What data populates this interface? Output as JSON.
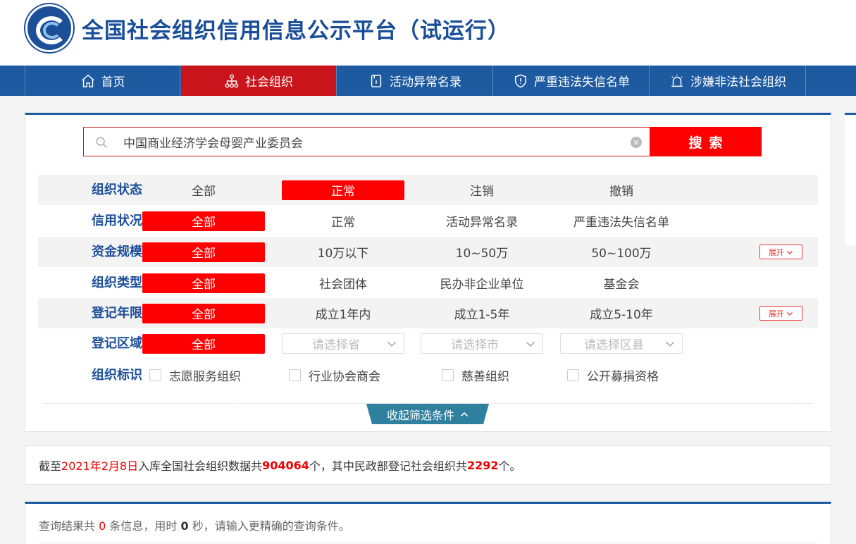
{
  "header": {
    "title": "全国社会组织信用信息公示平台（试运行）"
  },
  "nav": [
    {
      "label": "首页",
      "icon": "home-icon"
    },
    {
      "label": "社会组织",
      "icon": "org-icon"
    },
    {
      "label": "活动异常名录",
      "icon": "list-icon"
    },
    {
      "label": "严重违法失信名单",
      "icon": "shield-icon"
    },
    {
      "label": "涉嫌非法社会组织",
      "icon": "alarm-icon"
    }
  ],
  "search": {
    "value": "中国商业经济学会母婴产业委员会",
    "button": "搜索"
  },
  "filters": {
    "status": {
      "label": "组织状态",
      "options": [
        "全部",
        "正常",
        "注销",
        "撤销"
      ],
      "selected": "正常"
    },
    "credit": {
      "label": "信用状况",
      "options": [
        "全部",
        "正常",
        "活动异常名录",
        "严重违法失信名单"
      ],
      "selected": "全部"
    },
    "capital": {
      "label": "资金规模",
      "options": [
        "全部",
        "10万以下",
        "10~50万",
        "50~100万"
      ],
      "selected": "全部",
      "expand": "展开"
    },
    "type": {
      "label": "组织类型",
      "options": [
        "全部",
        "社会团体",
        "民办非企业单位",
        "基金会"
      ],
      "selected": "全部"
    },
    "years": {
      "label": "登记年限",
      "options": [
        "全部",
        "成立1年内",
        "成立1-5年",
        "成立5-10年"
      ],
      "selected": "全部",
      "expand": "展开"
    },
    "region": {
      "label": "登记区域",
      "all": "全部",
      "province": "请选择省",
      "city": "请选择市",
      "county": "请选择区县"
    },
    "mark": {
      "label": "组织标识",
      "options": [
        "志愿服务组织",
        "行业协会商会",
        "慈善组织",
        "公开募捐资格"
      ]
    },
    "collapse": "收起筛选条件"
  },
  "stats": {
    "prefix": "截至",
    "date": "2021年2月8日",
    "mid": "入库全国社会组织数据共",
    "total": "904064",
    "mid2": "个，其中民政部登记社会组织共",
    "ministry": "2292",
    "suffix": "个。"
  },
  "results": {
    "prefix": "查询结果共 ",
    "count": "0",
    "mid": " 条信息，用时 ",
    "time": "0",
    "suffix": " 秒，请输入更精确的查询条件。"
  },
  "colors": {
    "brand_blue": "#1d5aa0",
    "active_red": "#c9141b",
    "select_red": "#ff0000"
  }
}
